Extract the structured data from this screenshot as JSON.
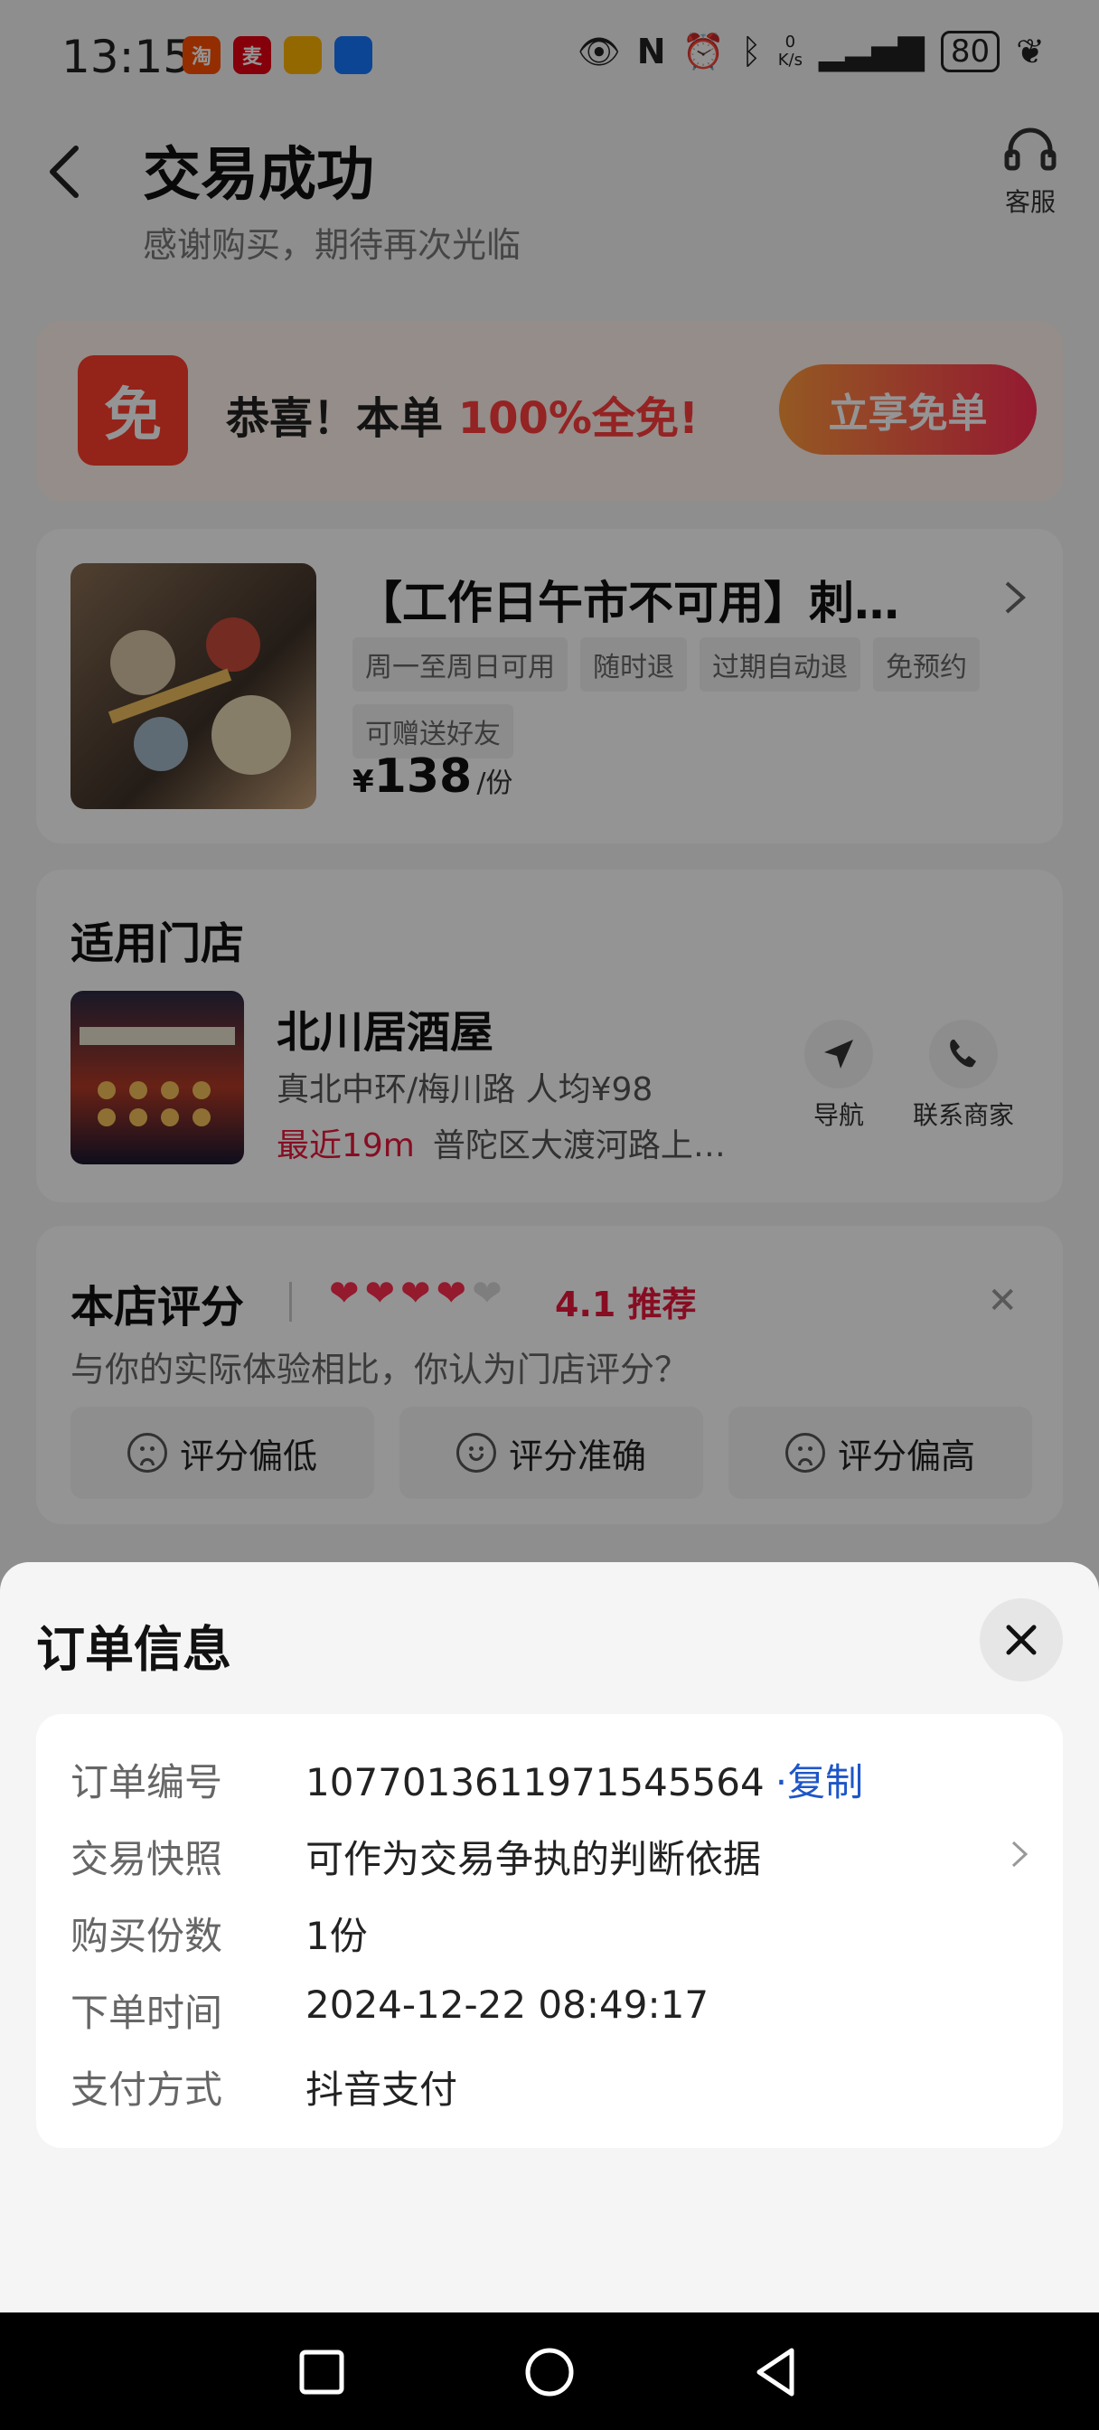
{
  "status_bar": {
    "time": "13:15",
    "app_icons": [
      "淘",
      "麦",
      "",
      ""
    ],
    "net_speed_value": "0",
    "net_speed_unit": "K/s",
    "battery": "80"
  },
  "header": {
    "title": "交易成功",
    "subtitle": "感谢购买，期待再次光临",
    "service_label": "客服"
  },
  "promo": {
    "badge": "免",
    "text_prefix": "恭喜！本单",
    "text_highlight": "100%全免!",
    "button_label": "立享免单"
  },
  "product": {
    "title": "【工作日午市不可用】刺…",
    "tags": [
      "周一至周日可用",
      "随时退",
      "过期自动退",
      "免预约",
      "可赠送好友"
    ],
    "price_currency": "¥",
    "price_value": "138",
    "price_unit": "/份"
  },
  "store": {
    "heading": "适用门店",
    "name": "北川居酒屋",
    "sub": "真北中环/梅川路  人均¥98",
    "distance": "最近19m",
    "address": "普陀区大渡河路上…",
    "nav_label": "导航",
    "contact_label": "联系商家"
  },
  "rating": {
    "heading": "本店评分",
    "stars_filled": 4,
    "stars_total": 5,
    "score_text": "4.1 推荐",
    "question": "与你的实际体验相比，你认为门店评分？",
    "options": [
      "评分偏低",
      "评分准确",
      "评分偏高"
    ]
  },
  "order_sheet": {
    "title": "订单信息",
    "rows": [
      {
        "label": "订单编号",
        "value": "1077013611971545564",
        "link": "·复制"
      },
      {
        "label": "交易快照",
        "value": "可作为交易争执的判断依据"
      },
      {
        "label": "购买份数",
        "value": "1份"
      },
      {
        "label": "下单时间",
        "value": "2024-12-22 08:49:17"
      },
      {
        "label": "支付方式",
        "value": "抖音支付"
      }
    ]
  },
  "colors": {
    "accent_red": "#e8173b",
    "promo_red": "#ff3d3d",
    "link_blue": "#1e56c8"
  }
}
